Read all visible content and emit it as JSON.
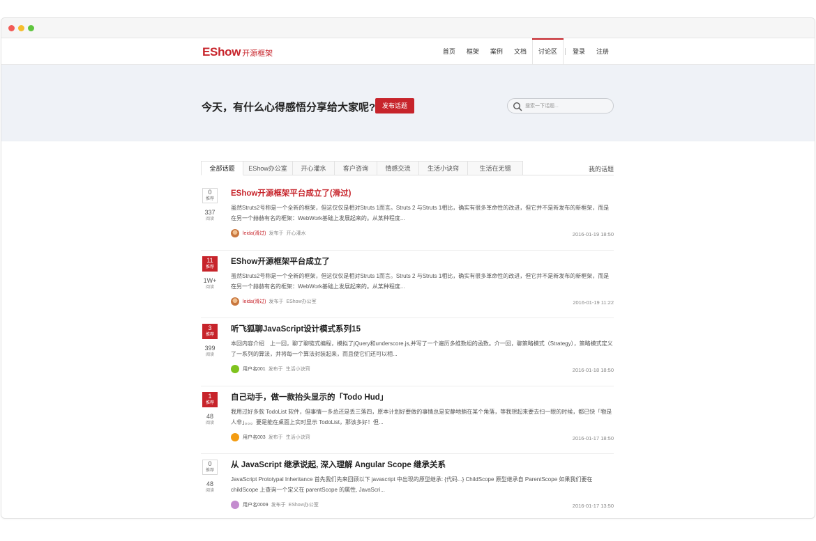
{
  "brand": {
    "name": "EShow",
    "subtitle": "开源框架"
  },
  "nav": [
    {
      "label": "首页"
    },
    {
      "label": "框架"
    },
    {
      "label": "案例"
    },
    {
      "label": "文档"
    },
    {
      "label": "讨论区",
      "active": true
    },
    {
      "label": "登录"
    },
    {
      "label": "注册"
    }
  ],
  "hero": {
    "title": "今天，有什么心得感悟分享给大家呢?",
    "post_button": "发布话题",
    "search_placeholder": "搜索一下话题..."
  },
  "tabs": [
    "全部话题",
    "EShow办公室",
    "开心灌水",
    "客户咨询",
    "情感交流",
    "生活小诀窍",
    "生活在无锡"
  ],
  "my_topics": "我的话题",
  "labels": {
    "recommend": "推荐",
    "views": "阅读",
    "posted_in": "发布于"
  },
  "colors": {
    "brand": "#c7242b"
  },
  "topics": [
    {
      "recommend": "0",
      "views": "337",
      "title": "EShow开源框架平台成立了(滑过)",
      "body": "虽然Struts2号称是一个全新的框架，但这仅仅是相对Struts 1而言。Struts 2 与Struts 1相比，确实有很多革命性的改进，但它并不是新发布的新框架，而是在另一个赫赫有名的框架：WebWork基础上发展起来的。从某种程度...",
      "author": "leida(滑过)",
      "category": "开心灌水",
      "date": "2016-01-19 18:50",
      "avatar_color": "#c9773e"
    },
    {
      "recommend": "11",
      "views": "1W+",
      "title": "EShow开源框架平台成立了",
      "body": "虽然Struts2号称是一个全新的框架，但这仅仅是相对Struts 1而言。Struts 2 与Struts 1相比，确实有很多革命性的改进，但它并不是新发布的新框架，而是在另一个赫赫有名的框架：WebWork基础上发展起来的。从某种程度...",
      "author": "leida(滑过)",
      "category": "EShow办公室",
      "date": "2016-01-19 11:22",
      "avatar_color": "#c9773e"
    },
    {
      "recommend": "3",
      "views": "399",
      "title": "听飞狐聊JavaScript设计模式系列15",
      "body": "本回内容介绍　上一回，聊了聊链式编程，模拟了jQuery和underscore.js,并写了一个遍历多维数组的函数。介一回，聊策略模式（Strategy），策略模式定义了一系列的算法，并将每一个算法封装起来，而且使它们还可以相...",
      "author": "用户名001",
      "category": "生活小诀窍",
      "date": "2016-01-18 18:50",
      "avatar_color": "#7fc31e"
    },
    {
      "recommend": "1",
      "views": "48",
      "title": "自己动手，做一款抬头显示的「Todo Hud」",
      "body": "我用过好多款 TodoList 软件，但事情一多总还是丢三落四，原本计划好要做的事情总是安静地躺在某个角落，等我想起来要去扫一眼的时候，都已快「物是人非」。。。要是能在桌面上实时显示 TodoList，那该多好！但...",
      "author": "用户名003",
      "category": "生活小诀窍",
      "date": "2016-01-17 18:50",
      "avatar_color": "#f39c12"
    },
    {
      "recommend": "0",
      "views": "48",
      "title": "从 JavaScript 继承说起, 深入理解 Angular Scope 继承关系",
      "body": "JavaScript Prototypal Inheritance 首先我们先来回顾以下 javascript 中出现的原型继承: {代码...} ChildScope 原型继承自 ParentScope 如果我们要在 childScope 上查询一个定义在 parentScope 的属性, JavaScri...",
      "author": "用户名0009",
      "category": "EShow办公室",
      "date": "2016-01-17 13:50",
      "avatar_color": "#c48ccf"
    }
  ]
}
